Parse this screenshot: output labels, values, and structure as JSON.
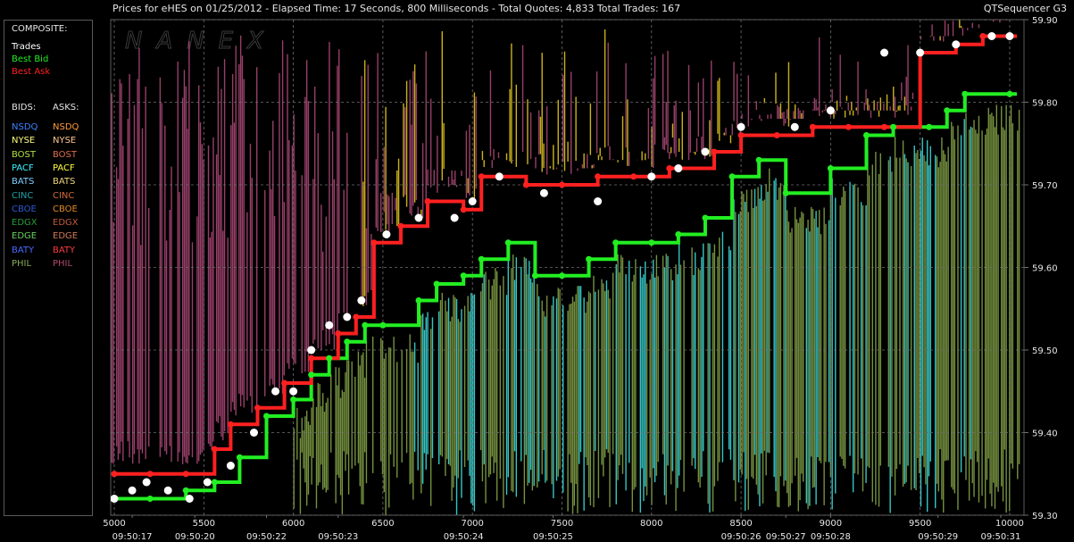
{
  "header": {
    "title": "Prices for  eHES  on  01/25/2012  -  Elapsed Time: 17 Seconds, 800 Milliseconds  -  Total Quotes: 4,833  Total Trades: 167",
    "brand": "QTSequencer G3",
    "watermark": "NANEX"
  },
  "legend": {
    "composite_label": "COMPOSITE:",
    "composite": [
      {
        "label": "Trades",
        "color": "#ffffff"
      },
      {
        "label": "Best Bid",
        "color": "#22ee22"
      },
      {
        "label": "Best Ask",
        "color": "#ff2020"
      }
    ],
    "bids_label": "BIDS:",
    "asks_label": "ASKS:",
    "exchanges": [
      {
        "bid": "NSDQ",
        "ask": "NSDQ",
        "bid_color": "#3c82ff",
        "ask_color": "#ff9a3c"
      },
      {
        "bid": "NYSE",
        "ask": "NYSE",
        "bid_color": "#ffff80",
        "ask_color": "#ffc890"
      },
      {
        "bid": "BOST",
        "ask": "BOST",
        "bid_color": "#b0e040",
        "ask_color": "#e06a4a"
      },
      {
        "bid": "PACF",
        "ask": "PACF",
        "bid_color": "#3cf0ff",
        "ask_color": "#ffff3c"
      },
      {
        "bid": "BATS",
        "ask": "BATS",
        "bid_color": "#7cd0ff",
        "ask_color": "#f0d47a"
      },
      {
        "bid": "CINC",
        "ask": "CINC",
        "bid_color": "#1aa0a8",
        "ask_color": "#d06a3a"
      },
      {
        "bid": "CBOE",
        "ask": "CBOE",
        "bid_color": "#2a5ad0",
        "ask_color": "#e08a2a"
      },
      {
        "bid": "EDGX",
        "ask": "EDGX",
        "bid_color": "#2a9a3a",
        "ask_color": "#c05a3a"
      },
      {
        "bid": "EDGE",
        "ask": "EDGE",
        "bid_color": "#6ad060",
        "ask_color": "#d07a5a"
      },
      {
        "bid": "BATY",
        "ask": "BATY",
        "bid_color": "#4a6aff",
        "ask_color": "#ff3a3a"
      },
      {
        "bid": "PHIL",
        "ask": "PHIL",
        "bid_color": "#8aaa5a",
        "ask_color": "#b04a6a"
      }
    ]
  },
  "colors": {
    "background": "#000000",
    "grid": "#707070",
    "text": "#e6e6e6",
    "trades": "#ffffff",
    "best_bid": "#22ee22",
    "best_ask": "#ff2020",
    "ask_fill": "#b04a7a",
    "ask_yellow": "#f0d020",
    "bid_fill": "#8aaa4a",
    "bid_cyan": "#40e8e8"
  },
  "chart_data": {
    "type": "line",
    "title": "",
    "xlabel": "",
    "ylabel": "",
    "x_ticks": [
      5000,
      5500,
      6000,
      6500,
      7000,
      7500,
      8000,
      8500,
      9000,
      9500,
      10000
    ],
    "time_labels": [
      {
        "x": 5100,
        "label": "09:50:17"
      },
      {
        "x": 5450,
        "label": "09:50:20"
      },
      {
        "x": 5850,
        "label": "09:50:22"
      },
      {
        "x": 6250,
        "label": "09:50:23"
      },
      {
        "x": 6950,
        "label": "09:50:24"
      },
      {
        "x": 7450,
        "label": "09:50:25"
      },
      {
        "x": 8500,
        "label": "09:50:26"
      },
      {
        "x": 8750,
        "label": "09:50:27"
      },
      {
        "x": 9000,
        "label": "09:50:28"
      },
      {
        "x": 9600,
        "label": "09:50:29"
      },
      {
        "x": 9950,
        "label": "09:50:31"
      }
    ],
    "y_ticks": [
      59.3,
      59.4,
      59.5,
      59.6,
      59.7,
      59.8,
      59.9
    ],
    "xlim": [
      4980,
      10080
    ],
    "ylim": [
      59.3,
      59.9
    ],
    "grid": true,
    "series": [
      {
        "name": "Best Bid",
        "values": [
          [
            5000,
            59.32
          ],
          [
            5200,
            59.32
          ],
          [
            5400,
            59.33
          ],
          [
            5560,
            59.34
          ],
          [
            5700,
            59.37
          ],
          [
            5850,
            59.42
          ],
          [
            6000,
            59.44
          ],
          [
            6100,
            59.47
          ],
          [
            6200,
            59.49
          ],
          [
            6300,
            59.51
          ],
          [
            6400,
            59.53
          ],
          [
            6500,
            59.53
          ],
          [
            6700,
            59.56
          ],
          [
            6800,
            59.58
          ],
          [
            6950,
            59.59
          ],
          [
            7050,
            59.61
          ],
          [
            7200,
            59.63
          ],
          [
            7350,
            59.59
          ],
          [
            7500,
            59.59
          ],
          [
            7650,
            59.61
          ],
          [
            7800,
            59.63
          ],
          [
            8000,
            59.63
          ],
          [
            8150,
            59.64
          ],
          [
            8300,
            59.66
          ],
          [
            8450,
            59.71
          ],
          [
            8600,
            59.73
          ],
          [
            8750,
            59.69
          ],
          [
            9000,
            59.72
          ],
          [
            9200,
            59.76
          ],
          [
            9350,
            59.77
          ],
          [
            9550,
            59.77
          ],
          [
            9650,
            59.79
          ],
          [
            9750,
            59.81
          ],
          [
            10000,
            59.81
          ]
        ]
      },
      {
        "name": "Best Ask",
        "values": [
          [
            5000,
            59.35
          ],
          [
            5200,
            59.35
          ],
          [
            5400,
            59.35
          ],
          [
            5560,
            59.38
          ],
          [
            5650,
            59.41
          ],
          [
            5800,
            59.43
          ],
          [
            5950,
            59.46
          ],
          [
            6100,
            59.49
          ],
          [
            6250,
            59.52
          ],
          [
            6350,
            59.54
          ],
          [
            6450,
            59.63
          ],
          [
            6600,
            59.65
          ],
          [
            6750,
            59.68
          ],
          [
            6950,
            59.67
          ],
          [
            7050,
            59.71
          ],
          [
            7300,
            59.7
          ],
          [
            7500,
            59.7
          ],
          [
            7700,
            59.71
          ],
          [
            7900,
            59.71
          ],
          [
            8100,
            59.72
          ],
          [
            8350,
            59.74
          ],
          [
            8500,
            59.76
          ],
          [
            8700,
            59.76
          ],
          [
            8900,
            59.77
          ],
          [
            9100,
            59.77
          ],
          [
            9300,
            59.77
          ],
          [
            9500,
            59.86
          ],
          [
            9700,
            59.87
          ],
          [
            9850,
            59.88
          ],
          [
            10000,
            59.88
          ]
        ]
      },
      {
        "name": "Trades",
        "values": [
          [
            5000,
            59.32
          ],
          [
            5100,
            59.33
          ],
          [
            5180,
            59.34
          ],
          [
            5300,
            59.33
          ],
          [
            5420,
            59.32
          ],
          [
            5520,
            59.34
          ],
          [
            5650,
            59.36
          ],
          [
            5780,
            59.4
          ],
          [
            5900,
            59.45
          ],
          [
            6000,
            59.45
          ],
          [
            6100,
            59.5
          ],
          [
            6200,
            59.53
          ],
          [
            6300,
            59.54
          ],
          [
            6380,
            59.56
          ],
          [
            6520,
            59.64
          ],
          [
            6700,
            59.66
          ],
          [
            6900,
            59.66
          ],
          [
            7000,
            59.68
          ],
          [
            7150,
            59.71
          ],
          [
            7400,
            59.69
          ],
          [
            7700,
            59.68
          ],
          [
            8000,
            59.71
          ],
          [
            8150,
            59.72
          ],
          [
            8300,
            59.74
          ],
          [
            8500,
            59.77
          ],
          [
            8800,
            59.77
          ],
          [
            9000,
            59.79
          ],
          [
            9300,
            59.86
          ],
          [
            9500,
            59.86
          ],
          [
            9700,
            59.87
          ],
          [
            9900,
            59.88
          ],
          [
            10000,
            59.88
          ]
        ]
      }
    ]
  }
}
